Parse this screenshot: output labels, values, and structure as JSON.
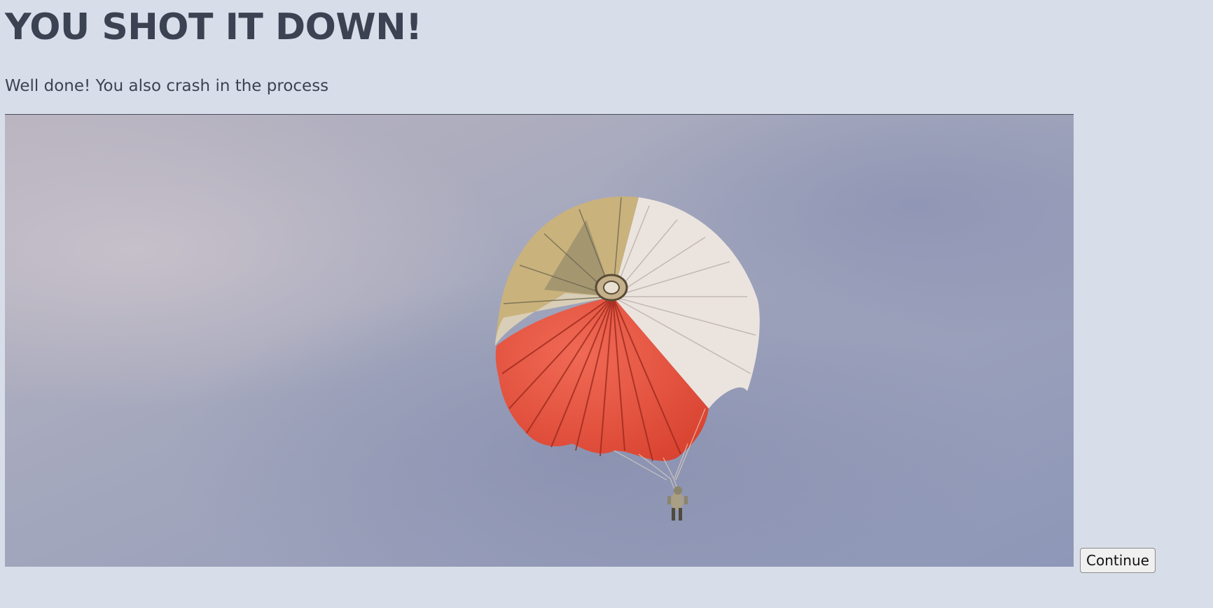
{
  "header": {
    "title": "YOU SHOT IT DOWN!",
    "subtitle": "Well done! You also crash in the process"
  },
  "scene": {
    "subject": "parachute-descending",
    "colors": {
      "sky": "#9aa3bd",
      "canopy_red": "#e8503d",
      "canopy_white": "#e9e2dc",
      "canopy_tan": "#c8b07a"
    }
  },
  "actions": {
    "continue_label": "Continue"
  },
  "theme": {
    "background": "#d8dee9",
    "text": "#3b4252"
  }
}
